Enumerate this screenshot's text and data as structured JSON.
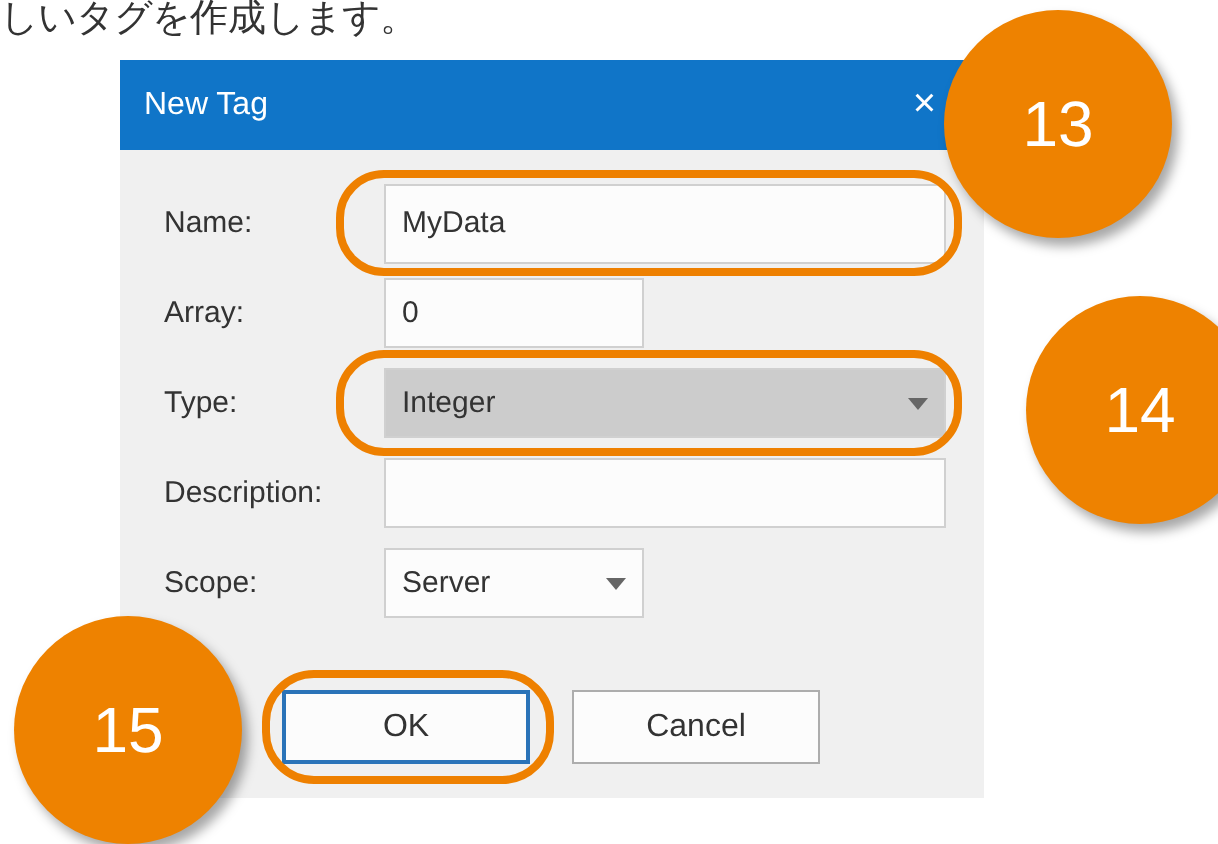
{
  "caption": "しいタグを作成します。",
  "dialog": {
    "title": "New Tag",
    "close": "×",
    "fields": [
      {
        "kind": "text",
        "label": "Name:",
        "value": "MyData",
        "highlighted": true,
        "selected": false
      },
      {
        "kind": "short",
        "label": "Array:",
        "value": "0",
        "highlighted": false,
        "selected": false
      },
      {
        "kind": "combo",
        "label": "Type:",
        "value": "Integer",
        "highlighted": true,
        "selected": true
      },
      {
        "kind": "text",
        "label": "Description:",
        "highlighted": false,
        "selected": false
      },
      {
        "kind": "shortcombo",
        "label": "Scope:",
        "value": "Server",
        "highlighted": false,
        "selected": false
      }
    ],
    "buttons": [
      {
        "label": "OK",
        "default": true,
        "highlighted": true
      },
      {
        "label": "Cancel",
        "default": false,
        "highlighted": false
      }
    ]
  },
  "callouts": [
    {
      "number": "13"
    },
    {
      "number": "14"
    },
    {
      "number": "15"
    }
  ]
}
